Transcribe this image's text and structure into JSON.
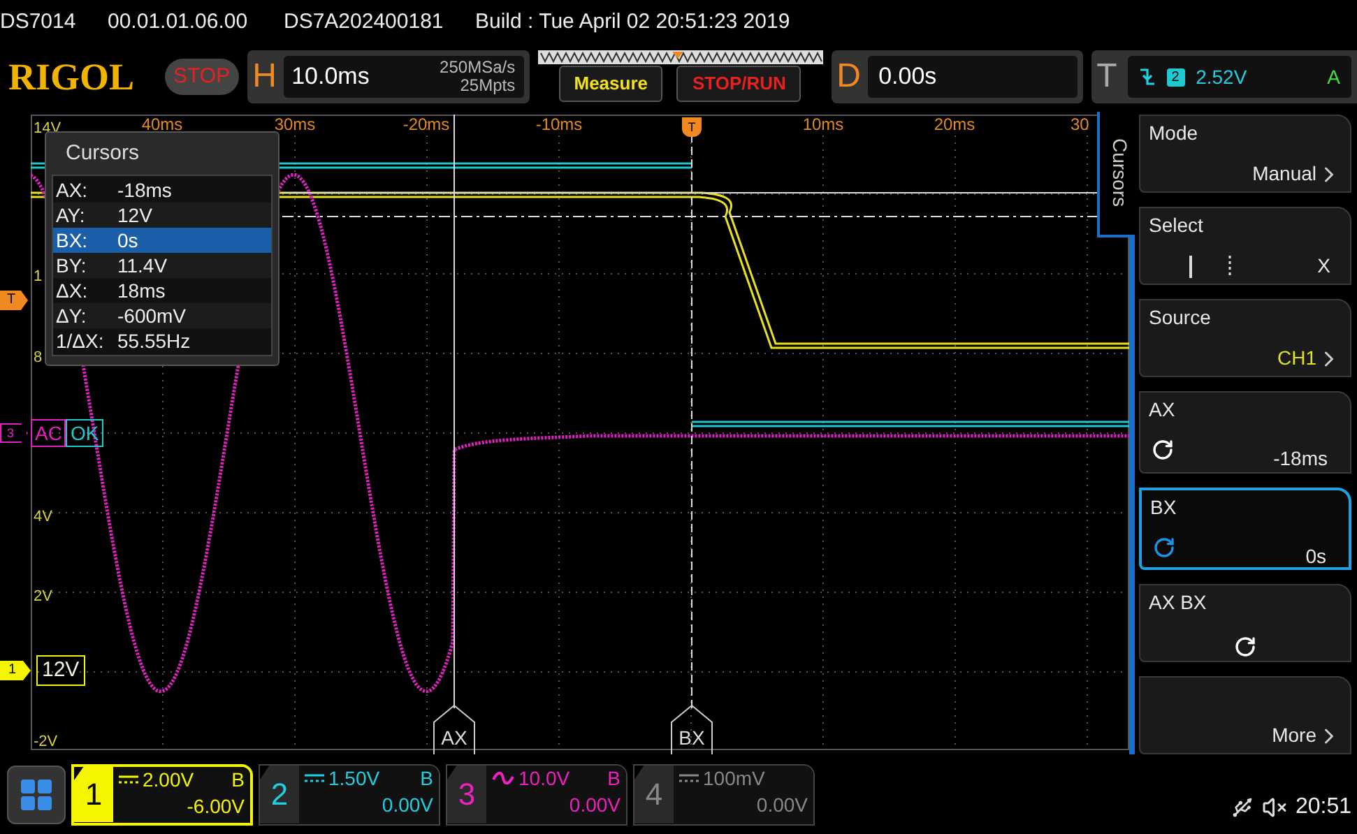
{
  "header": {
    "items": [
      "DS7014",
      "00.01.01.06.00",
      "DS7A202400181",
      "Build : Tue April 02 20:51:23 2019"
    ]
  },
  "toolbar": {
    "logo": "RIGOL",
    "run_state": "STOP",
    "horizontal": {
      "label": "H",
      "timebase": "10.0ms",
      "sample_rate": "250MSa/s",
      "memory_depth": "25Mpts"
    },
    "buttons": [
      {
        "label": "Measure",
        "color": "#f0e020"
      },
      {
        "label": "STOP/RUN",
        "color": "#e82020"
      }
    ],
    "delay": {
      "label": "D",
      "value": "0.00s"
    },
    "trigger": {
      "label": "T",
      "source": "2",
      "level": "2.52V",
      "mode": "A"
    }
  },
  "plot": {
    "time_labels": [
      "40ms",
      "30ms",
      "-20ms",
      "-10ms",
      "10ms",
      "20ms",
      "30"
    ],
    "volt_labels": [
      "14V",
      "1",
      "8",
      "4V",
      "2V",
      "-2V"
    ],
    "trigger_position": "T",
    "trigger_level_marker": "T",
    "ch3_marker": {
      "number": "3",
      "tags": [
        "AC",
        "OK"
      ]
    },
    "ch1_marker": {
      "number": "1",
      "label": "12V"
    },
    "cursor_labels": [
      "AX",
      "BX"
    ]
  },
  "cursors_panel": {
    "title": "Cursors",
    "rows": [
      {
        "label": "AX:",
        "value": "-18ms",
        "selected": false
      },
      {
        "label": "AY:",
        "value": "12V",
        "selected": false
      },
      {
        "label": "BX:",
        "value": "0s",
        "selected": true
      },
      {
        "label": "BY:",
        "value": "11.4V",
        "selected": false
      },
      {
        "label": "ΔX:",
        "value": "18ms",
        "selected": false
      },
      {
        "label": "ΔY:",
        "value": "-600mV",
        "selected": false
      },
      {
        "label": "1/ΔX:",
        "value": "55.55Hz",
        "selected": false
      }
    ]
  },
  "side_menu": {
    "tab": "Cursors",
    "items": [
      {
        "kind": "value",
        "title": "Mode",
        "value": "Manual",
        "arrow": true,
        "color": "#e8e8e8",
        "selected": false
      },
      {
        "kind": "select",
        "title": "Select",
        "value": "X",
        "color": "#e8e8e8",
        "selected": false
      },
      {
        "kind": "value",
        "title": "Source",
        "value": "CH1",
        "arrow": true,
        "color": "#e0e020",
        "selected": false
      },
      {
        "kind": "knob",
        "title": "AX",
        "value": "-18ms",
        "color": "#e8e8e8",
        "selected": false
      },
      {
        "kind": "knob",
        "title": "BX",
        "value": "0s",
        "color": "#e8e8e8",
        "selected": true
      },
      {
        "kind": "knob",
        "title": "AX BX",
        "selected": false
      },
      {
        "kind": "value",
        "value": "More",
        "arrow": true,
        "color": "#e8e8e8",
        "selected": false
      }
    ]
  },
  "channels": [
    {
      "number": "1",
      "kind": "dc",
      "scale": "2.00V",
      "bw": "B",
      "offset": "-6.00V",
      "color": "#f5f500",
      "selected": true,
      "enabled": true
    },
    {
      "number": "2",
      "kind": "dc",
      "scale": "1.50V",
      "bw": "B",
      "offset": "0.00V",
      "color": "#20d0e0",
      "selected": false,
      "enabled": true
    },
    {
      "number": "3",
      "kind": "ac",
      "scale": "10.0V",
      "bw": "B",
      "offset": "0.00V",
      "color": "#f020c0",
      "selected": false,
      "enabled": true
    },
    {
      "number": "4",
      "kind": "dc",
      "scale": "100mV",
      "offset": "0.00V",
      "selected": false,
      "enabled": false
    }
  ],
  "status": {
    "time": "20:51"
  }
}
